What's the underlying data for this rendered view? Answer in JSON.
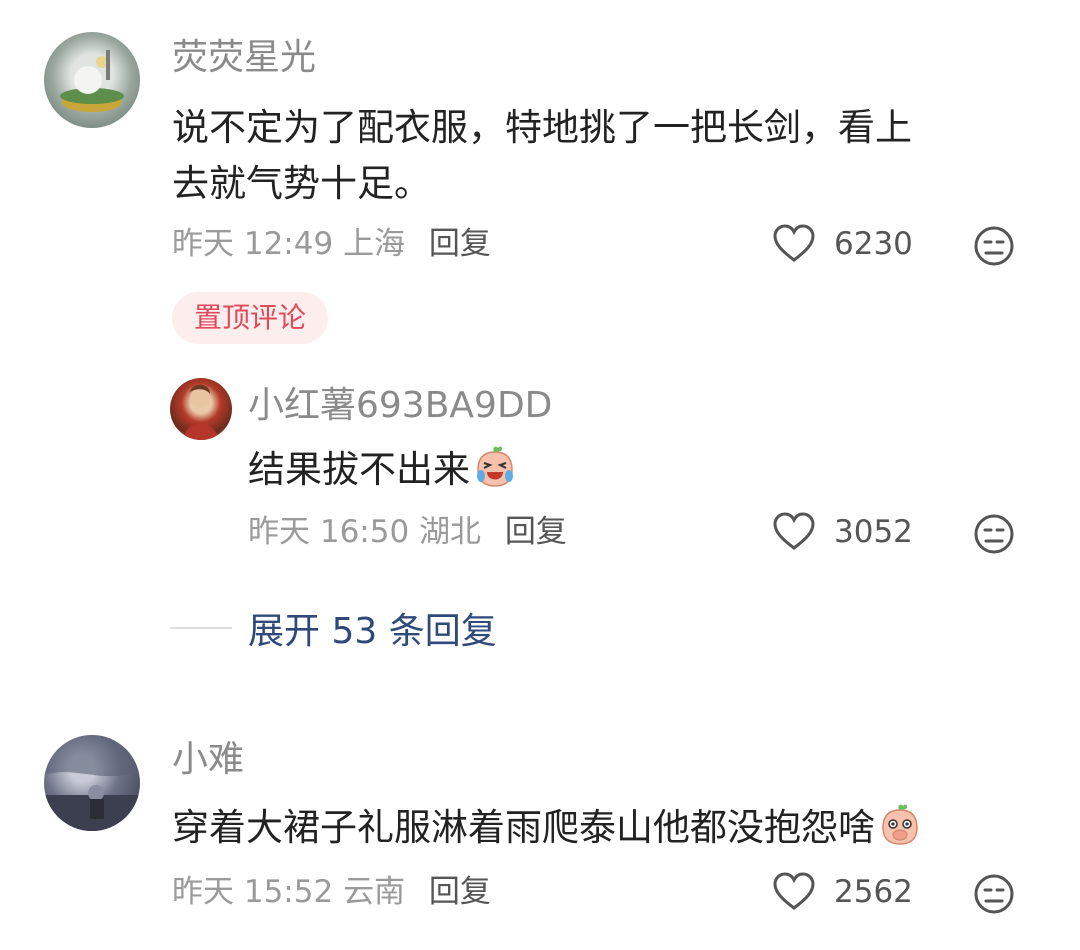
{
  "comments": [
    {
      "username": "荧荧星光",
      "text_line1": "说不定为了配衣服，特地挑了一把长剑，看上",
      "text_line2": "去就气势十足。",
      "time": "昨天 12:49",
      "location": "上海",
      "reply_label": "回复",
      "likes": "6230",
      "pinned_label": "置顶评论"
    },
    {
      "username": "小红薯693BA9DD",
      "text": "结果拔不出来",
      "emoji": "laughing-crying-emoji",
      "time": "昨天 16:50",
      "location": "湖北",
      "reply_label": "回复",
      "likes": "3052"
    },
    {
      "username": "小难",
      "text": "穿着大裙子礼服淋着雨爬泰山他都没抱怨啥",
      "emoji": "shocked-covering-mouth-emoji",
      "time": "昨天 15:52",
      "location": "云南",
      "reply_label": "回复",
      "likes": "2562"
    }
  ],
  "expand_replies": "展开 53 条回复",
  "icons": {
    "like": "heart-outline-icon",
    "dislike": "meh-face-icon"
  },
  "colors": {
    "pinned_badge_bg": "#fdeeee",
    "pinned_badge_text": "#e0495a",
    "expand_text": "#2f4a7a"
  }
}
